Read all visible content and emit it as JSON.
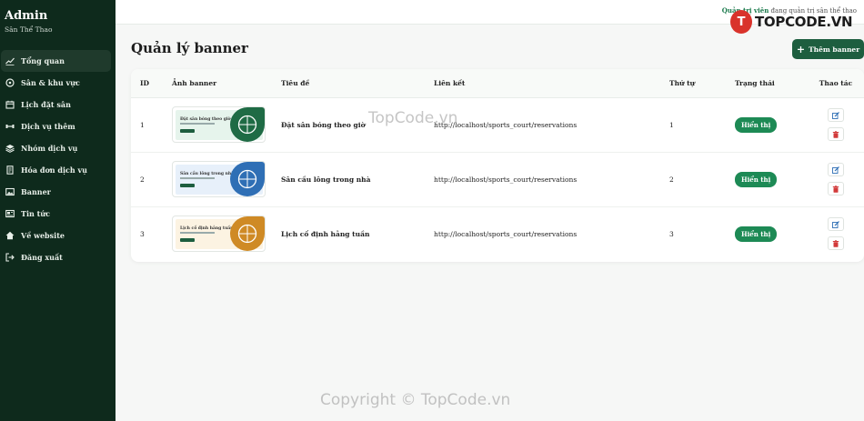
{
  "sidebar": {
    "brand_title": "Admin",
    "brand_subtitle": "Sân Thể Thao",
    "items": [
      {
        "label": "Tổng quan",
        "icon": "chart-line-icon",
        "active": true
      },
      {
        "label": "Sân & khu vực",
        "icon": "football-icon",
        "active": false
      },
      {
        "label": "Lịch đặt sân",
        "icon": "calendar-icon",
        "active": false
      },
      {
        "label": "Dịch vụ thêm",
        "icon": "dumbbell-icon",
        "active": false
      },
      {
        "label": "Nhóm dịch vụ",
        "icon": "layers-icon",
        "active": false
      },
      {
        "label": "Hóa đơn dịch vụ",
        "icon": "receipt-icon",
        "active": false
      },
      {
        "label": "Banner",
        "icon": "image-icon",
        "active": false
      },
      {
        "label": "Tin tức",
        "icon": "newspaper-icon",
        "active": false
      },
      {
        "label": "Về website",
        "icon": "home-icon",
        "active": false
      },
      {
        "label": "Đăng xuất",
        "icon": "logout-icon",
        "active": false
      }
    ]
  },
  "topbar": {
    "role": "Quản trị viên",
    "status_text": "đang quản trị sân thể thao"
  },
  "page": {
    "title": "Quản lý banner",
    "add_button": "Thêm banner"
  },
  "table": {
    "headers": {
      "id": "ID",
      "image": "Ảnh banner",
      "title": "Tiêu đề",
      "link": "Liên kết",
      "order": "Thứ tự",
      "status": "Trạng thái",
      "actions": "Thao tác"
    },
    "rows": [
      {
        "id": "1",
        "banner_text": "Đặt sân bóng theo giờ",
        "title": "Đặt sân bóng theo giờ",
        "link": "http://localhost/sports_court/reservations",
        "order": "1",
        "status": "Hiển thị",
        "theme_bg": "#e6f4ec",
        "theme_accent": "#1f6b45"
      },
      {
        "id": "2",
        "banner_text": "Sân cầu lông trong nhà",
        "title": "Sân cầu lông trong nhà",
        "link": "http://localhost/sports_court/reservations",
        "order": "2",
        "status": "Hiển thị",
        "theme_bg": "#e7f0fa",
        "theme_accent": "#2f6fb5"
      },
      {
        "id": "3",
        "banner_text": "Lịch cố định hằng tuần",
        "title": "Lịch cố định hằng tuần",
        "link": "http://localhost/sports_court/reservations",
        "order": "3",
        "status": "Hiển thị",
        "theme_bg": "#fcf3e2",
        "theme_accent": "#cf8a25"
      }
    ]
  },
  "watermark": {
    "center": "TopCode.vn",
    "bottom": "Copyright © TopCode.vn",
    "logo": "TOPCODE.VN"
  },
  "colors": {
    "sidebar_bg": "#0e2a1c",
    "primary": "#1d5e3f",
    "badge": "#1d8a55",
    "edit": "#2f6fb5",
    "delete": "#d23a3a"
  }
}
